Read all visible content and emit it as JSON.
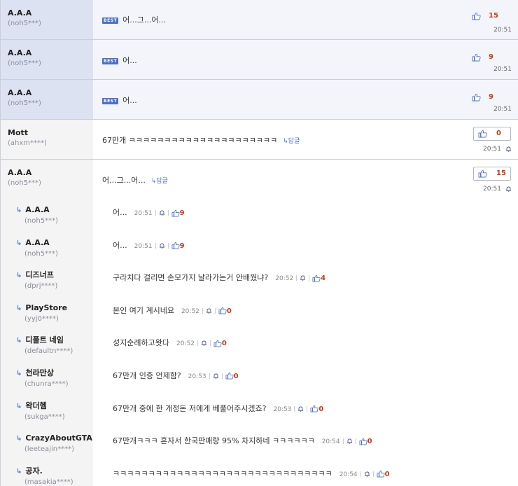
{
  "best_comments": [
    {
      "nick": "A.A.A",
      "uid": "(noh5***)",
      "badge": "BEST",
      "text": "어...그...어...",
      "likes": "15",
      "time": "20:51"
    },
    {
      "nick": "A.A.A",
      "uid": "(noh5***)",
      "badge": "BEST",
      "text": "어...",
      "likes": "9",
      "time": "20:51"
    },
    {
      "nick": "A.A.A",
      "uid": "(noh5***)",
      "badge": "BEST",
      "text": "어...",
      "likes": "9",
      "time": "20:51"
    }
  ],
  "comments": [
    {
      "nick": "Mott",
      "uid": "(ahxm****)",
      "text": "67만개 ㅋㅋㅋㅋㅋㅋㅋㅋㅋㅋㅋㅋㅋㅋㅋㅋㅋㅋㅋㅋㅋ",
      "reply_label": "↳답글",
      "likes": "0",
      "time": "20:51"
    },
    {
      "nick": "A.A.A",
      "uid": "(noh5***)",
      "text": "어...그...어...",
      "reply_label": "↳답글",
      "likes": "15",
      "time": "20:51"
    }
  ],
  "replies": [
    {
      "nick": "A.A.A",
      "uid": "(noh5***)",
      "text": "어...",
      "time": "20:51",
      "likes": "9"
    },
    {
      "nick": "A.A.A",
      "uid": "(noh5***)",
      "text": "어...",
      "time": "20:51",
      "likes": "9"
    },
    {
      "nick": "디즈너프",
      "uid": "(dprj****)",
      "text": "구라치다 걸리면 손모가지 날라가는거 안배웠냐?",
      "time": "20:52",
      "likes": "4"
    },
    {
      "nick": "PlayStore",
      "uid": "(yyj0****)",
      "text": "본인 여기 계시네요",
      "time": "20:52",
      "likes": "0"
    },
    {
      "nick": "디폴트 네임",
      "uid": "(defaultn****)",
      "text": "성지순례하고왓다",
      "time": "20:52",
      "likes": "0"
    },
    {
      "nick": "천라만상",
      "uid": "(chunra****)",
      "text": "67만개 인증 언제함?",
      "time": "20:53",
      "likes": "0"
    },
    {
      "nick": "왁더헴",
      "uid": "(sukga****)",
      "text": "67만개 중에 한 개정돈 저에게 베풀어주시겠죠?",
      "time": "20:53",
      "likes": "0"
    },
    {
      "nick": "CrazyAboutGTA",
      "uid": "(leeteajin****)",
      "text": "67만개ㅋㅋㅋ 혼자서 한국판매량 95% 차지하네 ㅋㅋㅋㅋㅋㅋ",
      "time": "20:54",
      "likes": "0"
    },
    {
      "nick": "공자.",
      "uid": "(masakia****)",
      "text": "ㅋㅋㅋㅋㅋㅋㅋㅋㅋㅋㅋㅋㅋㅋㅋㅋㅋㅋㅋㅋㅋㅋㅋㅋㅋㅋㅋㅋㅋㅋㅋ",
      "time": "20:54",
      "likes": "0"
    }
  ],
  "icons": {
    "reply_arrow": "↳",
    "thumb": "thumbs-up-icon",
    "bell": "report-bell-icon"
  },
  "colors": {
    "accent": "#4d6fcb",
    "count": "#cc3a14",
    "best_bg": "#f3f5fb",
    "author_best_bg": "#dde2f2"
  }
}
